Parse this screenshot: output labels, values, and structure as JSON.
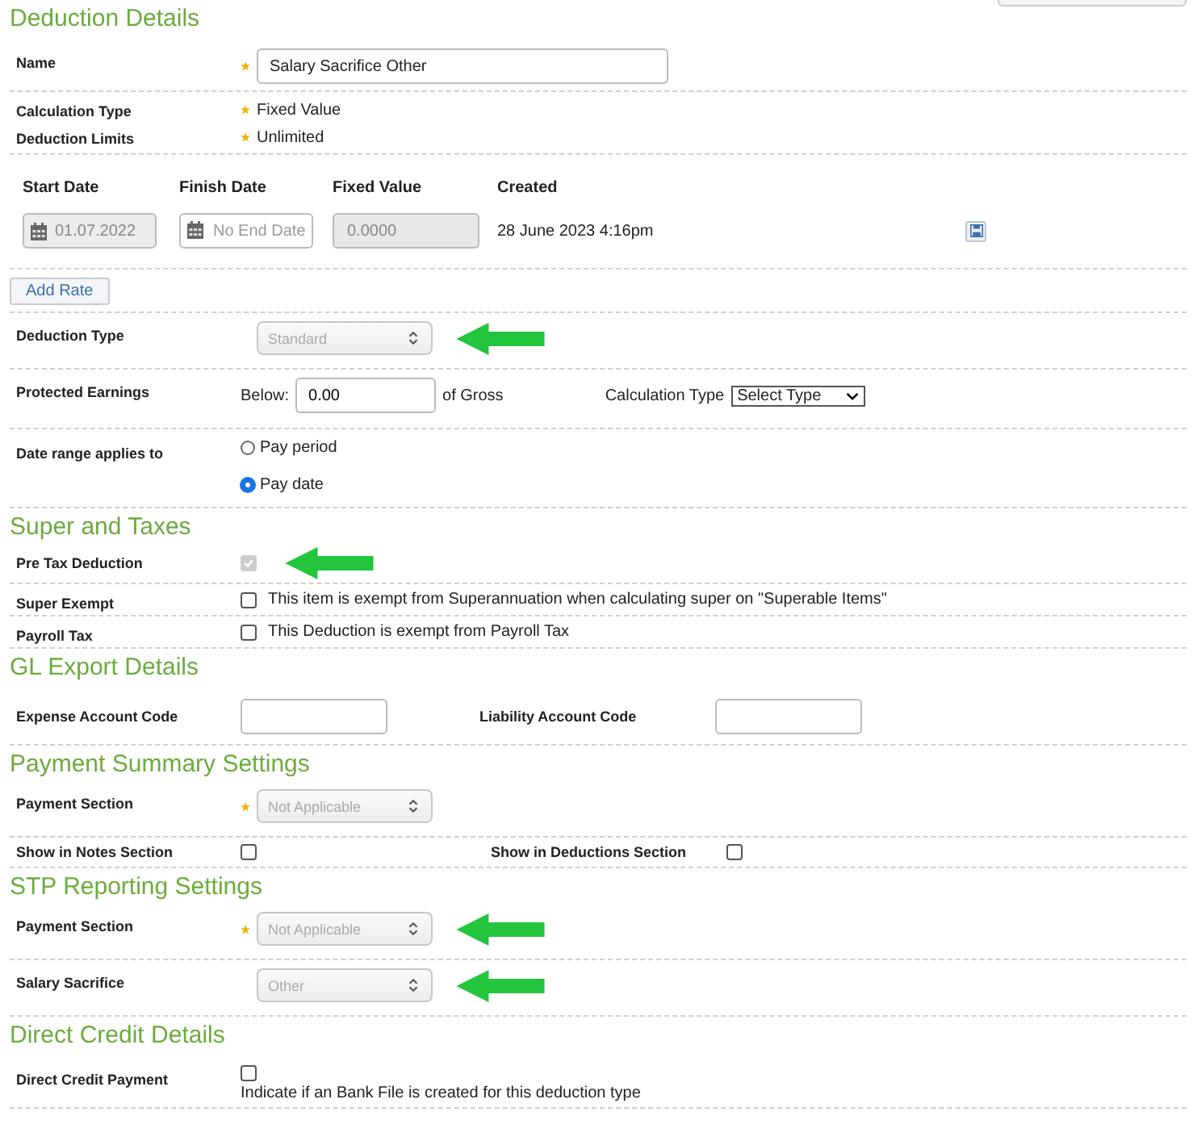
{
  "sections": [
    {
      "title": "Deduction Details",
      "rows": [
        {
          "kind": "input",
          "label": "Name",
          "required": true,
          "value": "Salary Sacrifice Other"
        },
        {
          "kind": "value",
          "label": "Calculation Type",
          "required": true,
          "value": "Fixed Value"
        },
        {
          "kind": "value",
          "label": "Deduction Limits",
          "required": true,
          "value": "Unlimited"
        },
        {
          "kind": "rates",
          "columns": [
            "Start Date",
            "Finish Date",
            "Fixed Value",
            "Created"
          ],
          "start_date": "01.07.2022",
          "finish_placeholder": "No End Date",
          "fixed_value": "0.0000",
          "created": "28 June 2023 4:16pm"
        },
        {
          "kind": "button",
          "label": "Add Rate"
        },
        {
          "kind": "select",
          "label": "Deduction Type",
          "required": false,
          "value": "Standard",
          "disabled": true,
          "arrow": true
        },
        {
          "kind": "protected",
          "label": "Protected Earnings",
          "below_label": "Below:",
          "below_value": "0.00",
          "suffix": "of Gross",
          "calc_label": "Calculation Type",
          "calc_value": "Select Type"
        },
        {
          "kind": "radios",
          "label": "Date range applies to",
          "options": [
            {
              "label": "Pay period",
              "selected": false
            },
            {
              "label": "Pay date",
              "selected": true
            }
          ]
        }
      ]
    },
    {
      "title": "Super and Taxes",
      "rows": [
        {
          "kind": "checkbox",
          "label": "Pre Tax Deduction",
          "checked": true,
          "disabled": true,
          "arrow": true
        },
        {
          "kind": "checkbox",
          "label": "Super Exempt",
          "checked": false,
          "disabled": false,
          "text": "This item is exempt from Superannuation when calculating super on \"Superable Items\""
        },
        {
          "kind": "checkbox",
          "label": "Payroll Tax",
          "checked": false,
          "disabled": false,
          "text": "This Deduction is exempt from Payroll Tax"
        }
      ]
    },
    {
      "title": "GL Export Details",
      "rows": [
        {
          "kind": "pair_inputs",
          "items": [
            {
              "label": "Expense Account Code"
            },
            {
              "label": "Liability Account Code"
            }
          ]
        }
      ]
    },
    {
      "title": "Payment Summary Settings",
      "rows": [
        {
          "kind": "select",
          "label": "Payment Section",
          "required": true,
          "value": "Not Applicable",
          "disabled": true,
          "arrow": false
        },
        {
          "kind": "pair_checks",
          "items": [
            {
              "label": "Show in Notes Section",
              "checked": false
            },
            {
              "label": "Show in Deductions Section",
              "checked": false
            }
          ]
        }
      ]
    },
    {
      "title": "STP Reporting Settings",
      "rows": [
        {
          "kind": "select",
          "label": "Payment Section",
          "required": true,
          "value": "Not Applicable",
          "disabled": true,
          "arrow": true
        },
        {
          "kind": "select",
          "label": "Salary Sacrifice",
          "required": false,
          "value": "Other",
          "disabled": true,
          "arrow": true
        }
      ]
    },
    {
      "title": "Direct Credit Details",
      "rows": [
        {
          "kind": "checkbox_below",
          "label": "Direct Credit Payment",
          "checked": false,
          "disabled": false,
          "text": "Indicate if an Bank File is created for this deduction type"
        }
      ]
    }
  ]
}
